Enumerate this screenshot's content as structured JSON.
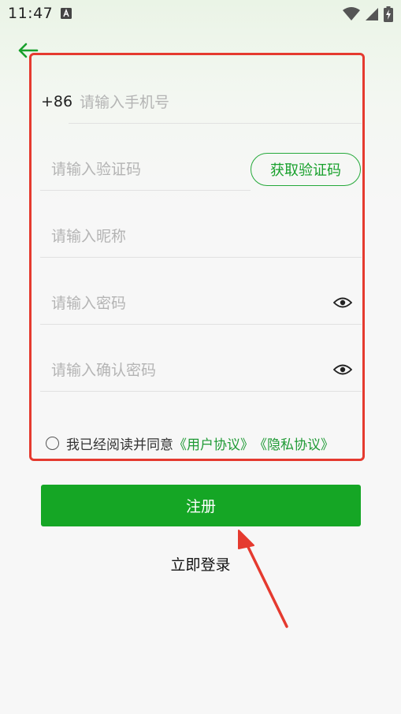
{
  "status_bar": {
    "time": "11:47",
    "icons": [
      "text-notification-icon",
      "wifi-icon",
      "signal-icon",
      "battery-charging-icon"
    ]
  },
  "header": {
    "back_icon": "arrow-left-icon"
  },
  "form": {
    "country_code": "+86",
    "phone_placeholder": "请输入手机号",
    "code_placeholder": "请输入验证码",
    "get_code_label": "获取验证码",
    "nickname_placeholder": "请输入昵称",
    "password_placeholder": "请输入密码",
    "confirm_password_placeholder": "请输入确认密码",
    "password_toggle_icon": "eye-icon",
    "agreement": {
      "text": "我已经阅读并同意",
      "user_agreement": "《用户协议》",
      "privacy_agreement": "《隐私协议》",
      "checked": false
    }
  },
  "actions": {
    "register_label": "注册",
    "login_label": "立即登录"
  },
  "colors": {
    "primary_green": "#15a625",
    "link_green": "#1f9a35",
    "annotation_red": "#e53a2f"
  }
}
